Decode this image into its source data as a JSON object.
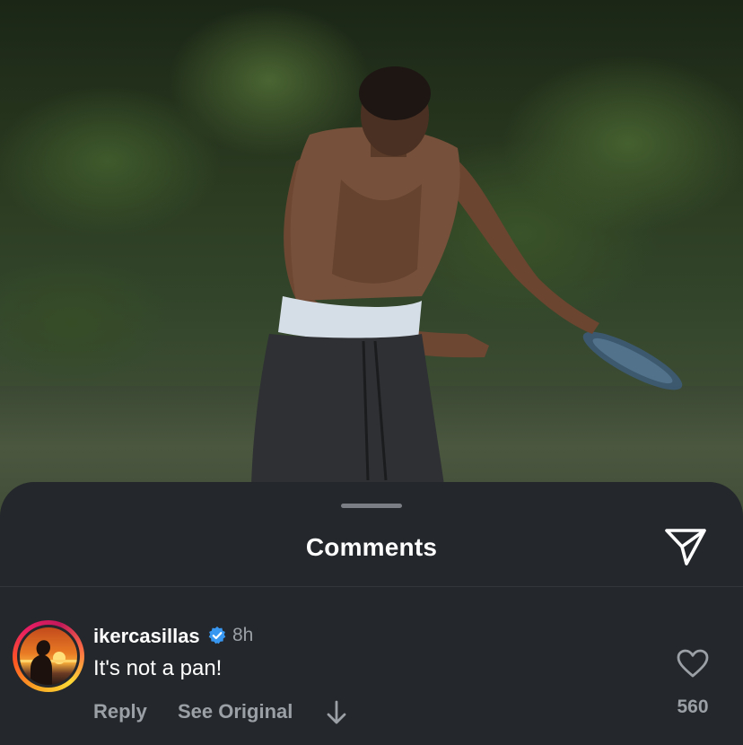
{
  "sheet": {
    "title": "Comments"
  },
  "comment": {
    "username": "ikercasillas",
    "time": "8h",
    "text": "It's not a pan!",
    "reply_label": "Reply",
    "see_original_label": "See Original",
    "like_count": "560"
  },
  "icons": {
    "send": "paper-plane-icon",
    "verified": "verified-badge-icon",
    "heart": "heart-icon",
    "arrow": "arrow-down-icon"
  },
  "colors": {
    "sheet_background": "#24272b",
    "verified_blue": "#3897f0",
    "muted_text": "#9aa0a6"
  }
}
